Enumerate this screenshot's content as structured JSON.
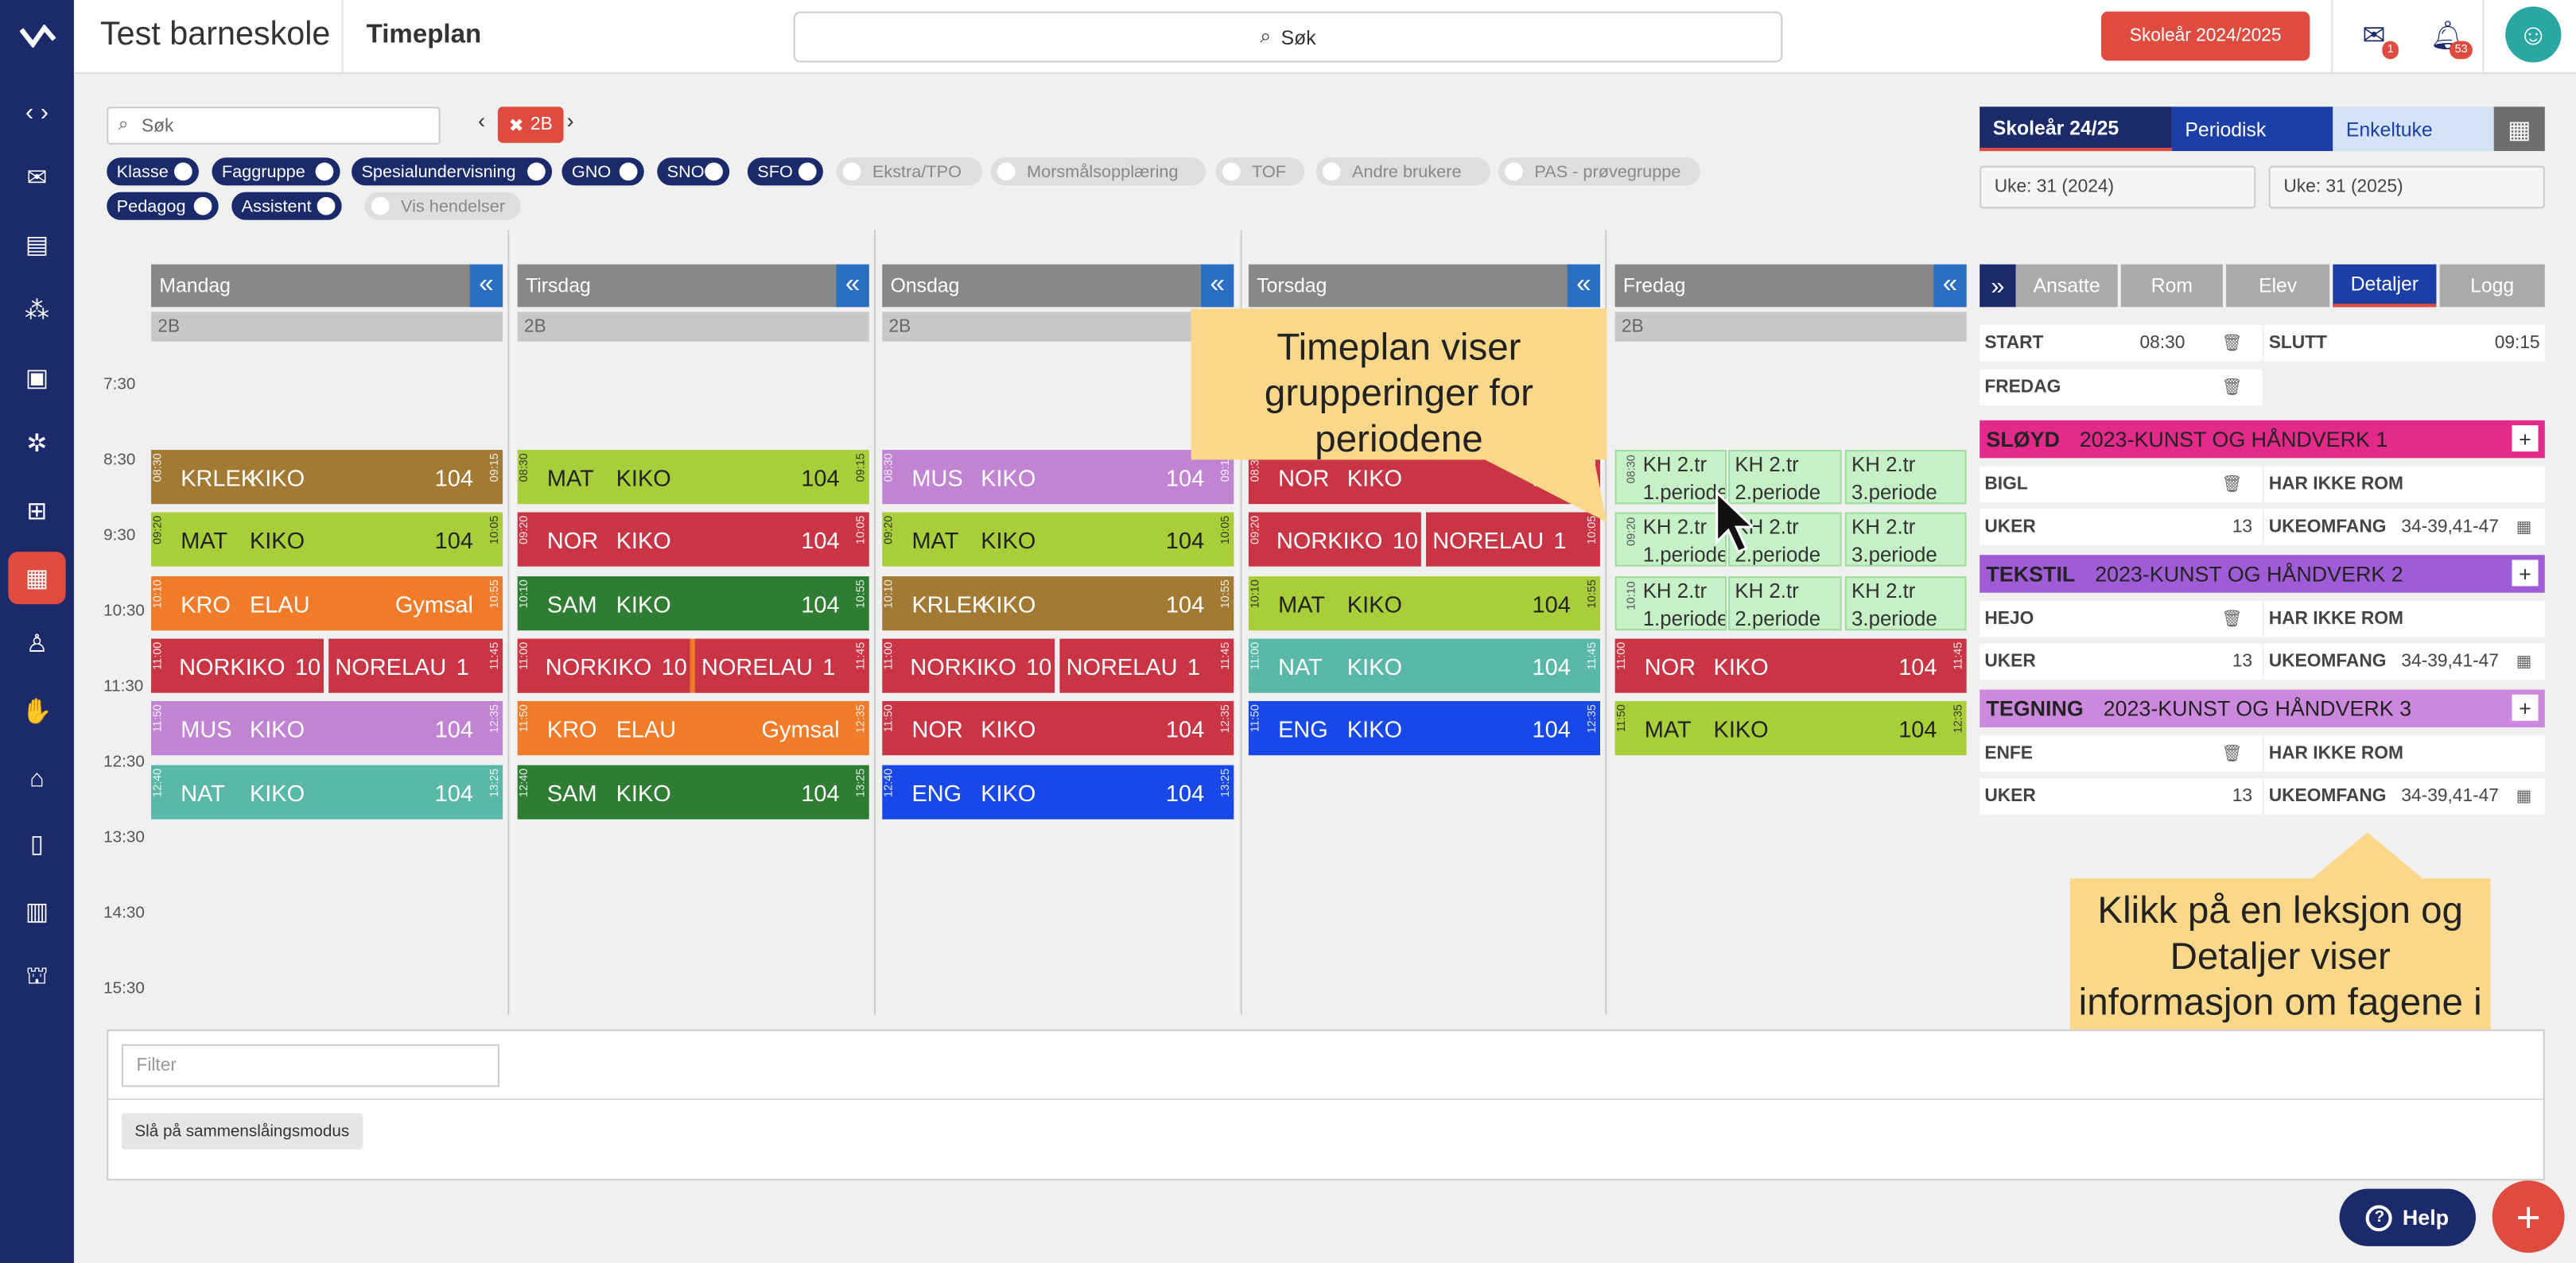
{
  "app": {
    "school_name": "Test barneskole",
    "page_title": "Timeplan",
    "search_label": "Søk",
    "school_year_button": "Skoleår 2024/2025",
    "mail_badge": "1",
    "notif_badge": "53"
  },
  "filters": {
    "search_placeholder": "Søk",
    "group_tag": "2B",
    "toggles_row1": [
      {
        "label": "Klasse",
        "on": true
      },
      {
        "label": "Faggruppe",
        "on": true
      },
      {
        "label": "Spesialundervisning",
        "on": true
      },
      {
        "label": "GNO",
        "on": true
      },
      {
        "label": "SNO",
        "on": true
      },
      {
        "label": "SFO",
        "on": true
      },
      {
        "label": "Ekstra/TPO",
        "on": false
      },
      {
        "label": "Morsmålsopplæring",
        "on": false
      },
      {
        "label": "TOF",
        "on": false
      },
      {
        "label": "Andre brukere",
        "on": false
      },
      {
        "label": "PAS - prøvegruppe",
        "on": false
      }
    ],
    "toggles_row2": [
      {
        "label": "Pedagog",
        "on": true
      },
      {
        "label": "Assistent",
        "on": true
      },
      {
        "label": "Vis hendelser",
        "on": false
      }
    ]
  },
  "days": [
    "Mandag",
    "Tirsdag",
    "Onsdag",
    "Torsdag",
    "Fredag"
  ],
  "class_label": "2B",
  "times": [
    "7:30",
    "8:30",
    "9:30",
    "10:30",
    "11:30",
    "12:30",
    "13:30",
    "14:30",
    "15:30"
  ],
  "lessons": {
    "mon": [
      {
        "s": "KRLEK",
        "t": "KIKO",
        "r": "104",
        "ts": "08:30",
        "te": "09:15"
      },
      {
        "s": "MAT",
        "t": "KIKO",
        "r": "104",
        "ts": "09:20",
        "te": "10:05"
      },
      {
        "s": "KRO",
        "t": "ELAU",
        "r": "Gymsal",
        "ts": "10:10",
        "te": "10:55"
      },
      {
        "s": "MUS",
        "t": "KIKO",
        "r": "104",
        "ts": "11:50",
        "te": "12:35"
      },
      {
        "s": "NAT",
        "t": "KIKO",
        "r": "104",
        "ts": "12:40",
        "te": "13:25"
      }
    ],
    "tue": [
      {
        "s": "MAT",
        "t": "KIKO",
        "r": "104",
        "ts": "08:30",
        "te": "09:15"
      },
      {
        "s": "NOR",
        "t": "KIKO",
        "r": "104",
        "ts": "09:20",
        "te": "10:05"
      },
      {
        "s": "SAM",
        "t": "KIKO",
        "r": "104",
        "ts": "10:10",
        "te": "10:55"
      },
      {
        "s": "KRO",
        "t": "ELAU",
        "r": "Gymsal",
        "ts": "11:00",
        "te": "11:45"
      },
      {
        "s": "KRO",
        "t": "ELAU",
        "r": "Gymsal",
        "ts": "11:50",
        "te": "12:35"
      },
      {
        "s": "SAM",
        "t": "KIKO",
        "r": "104",
        "ts": "12:40",
        "te": "13:25"
      }
    ],
    "wed": [
      {
        "s": "MUS",
        "t": "KIKO",
        "r": "104",
        "ts": "08:30",
        "te": "09:15"
      },
      {
        "s": "MAT",
        "t": "KIKO",
        "r": "104",
        "ts": "09:20",
        "te": "10:05"
      },
      {
        "s": "KRLEK",
        "t": "KIKO",
        "r": "104",
        "ts": "10:10",
        "te": "10:55"
      },
      {
        "s": "NOR",
        "t": "KIKO",
        "r": "104",
        "ts": "11:50",
        "te": "12:35"
      },
      {
        "s": "ENG",
        "t": "KIKO",
        "r": "104",
        "ts": "12:40",
        "te": "13:25"
      }
    ],
    "thu": [
      {
        "s": "NOR",
        "t": "KIKO",
        "r": "104",
        "ts": "08:30",
        "te": "09:15"
      },
      {
        "s": "MAT",
        "t": "KIKO",
        "r": "104",
        "ts": "10:10",
        "te": "10:55"
      },
      {
        "s": "NAT",
        "t": "KIKO",
        "r": "104",
        "ts": "11:00",
        "te": "11:45"
      },
      {
        "s": "ENG",
        "t": "KIKO",
        "r": "104",
        "ts": "11:50",
        "te": "12:35"
      }
    ],
    "fri": [
      {
        "s": "NOR",
        "t": "KIKO",
        "r": "104",
        "ts": "11:00",
        "te": "11:45"
      },
      {
        "s": "MAT",
        "t": "KIKO",
        "r": "104",
        "ts": "11:50",
        "te": "12:35"
      }
    ],
    "splits": {
      "mon": [
        "NORKIKO",
        "10",
        "NORELAU",
        "1"
      ],
      "tue": [
        "NORKIKO",
        "10",
        "NORELAU",
        "1"
      ],
      "wed": [
        "NORKIKO",
        "10",
        "NORELAU",
        "1"
      ],
      "thu": [
        "NORKIKO",
        "10",
        "NORELAU",
        "1"
      ]
    },
    "split_times": {
      "mon": [
        "11:00",
        "11:45"
      ],
      "tue": [
        "11:00",
        "11:45"
      ],
      "wed": [
        "11:00",
        "11:45"
      ],
      "thu": [
        "09:20",
        "10:05"
      ]
    },
    "kh_times": [
      "08:30",
      "09:20",
      "10:10"
    ],
    "kh": [
      [
        "KH 2.tr",
        "1.periode"
      ],
      [
        "KH 2.tr",
        "2.periode"
      ],
      [
        "KH 2.tr",
        "3.periode"
      ]
    ]
  },
  "right": {
    "tabs": [
      "Skoleår 24/25",
      "Periodisk",
      "Enkeltuke"
    ],
    "week_from": "Uke: 31 (2024)",
    "week_to": "Uke: 31 (2025)",
    "detail_tabs": [
      "Ansatte",
      "Rom",
      "Elev",
      "Detaljer",
      "Logg"
    ],
    "start_label": "START",
    "start_val": "08:30",
    "slutt_label": "SLUTT",
    "slutt_val": "09:15",
    "day_label": "FREDAG",
    "groups": [
      {
        "name": "SLØYD",
        "title": "2023-KUNST OG HÅNDVERK 1",
        "teacher": "BIGL",
        "room": "HAR IKKE ROM",
        "uker": "UKER",
        "uker_val": "13",
        "omfang": "UKEOMFANG",
        "omfang_val": "34-39,41-47",
        "color": "#e3298a"
      },
      {
        "name": "TEKSTIL",
        "title": "2023-KUNST OG HÅNDVERK 2",
        "teacher": "HEJO",
        "room": "HAR IKKE ROM",
        "uker": "UKER",
        "uker_val": "13",
        "omfang": "UKEOMFANG",
        "omfang_val": "34-39,41-47",
        "color": "#a05cd6"
      },
      {
        "name": "TEGNING",
        "title": "2023-KUNST OG HÅNDVERK 3",
        "teacher": "ENFE",
        "room": "HAR IKKE ROM",
        "uker": "UKER",
        "uker_val": "13",
        "omfang": "UKEOMFANG",
        "omfang_val": "34-39,41-47",
        "color": "#cc88dd"
      }
    ]
  },
  "callouts": {
    "top": "Timeplan viser grupperinger for periodene",
    "bottom": "Klikk på en leksjon og Detaljer viser informasjon om fagene i grupperingen"
  },
  "bottom": {
    "filter_placeholder": "Filter",
    "merge_button": "Slå på sammenslåingsmodus"
  },
  "help_label": "Help",
  "colors": {
    "navy": "#1b2a6b",
    "red": "#e04b3f",
    "blue": "#2b6fc2"
  },
  "icons": [
    "expand-icon",
    "mail-icon",
    "news-icon",
    "groups-icon",
    "badge-icon",
    "people-icon",
    "assignment-icon",
    "timetable-icon",
    "person-icon",
    "hand-icon",
    "school-icon",
    "document-icon",
    "chart-icon",
    "building-icon"
  ]
}
